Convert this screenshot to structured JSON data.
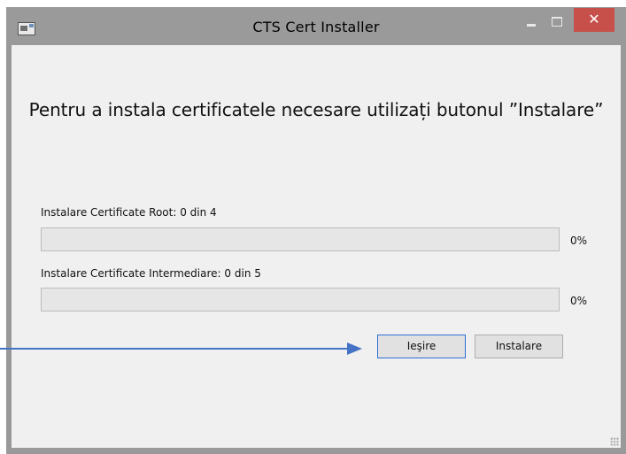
{
  "window": {
    "title": "CTS Cert Installer",
    "close_glyph": "✕",
    "icons": [
      "app-icon",
      "minimize-icon",
      "maximize-icon",
      "close-icon"
    ]
  },
  "main": {
    "heading": "Pentru a instala certificatele necesare utilizați butonul ”Instalare”",
    "root": {
      "label": "Instalare Certificate Root:",
      "count": "0 din 4",
      "percent_text": "0%",
      "progress": 0
    },
    "intermediate": {
      "label": "Instalare Certificate Intermediare:",
      "count": "0 din 5",
      "percent_text": "0%",
      "progress": 0
    },
    "buttons": {
      "exit": "Ieşire",
      "install": "Instalare"
    }
  },
  "colors": {
    "title_bar": "#9a9a9a",
    "client_background": "#f0f0f0",
    "close_button": "#c7504a",
    "progress_fill": "#06b025",
    "annotation_arrow": "#4472c4"
  }
}
